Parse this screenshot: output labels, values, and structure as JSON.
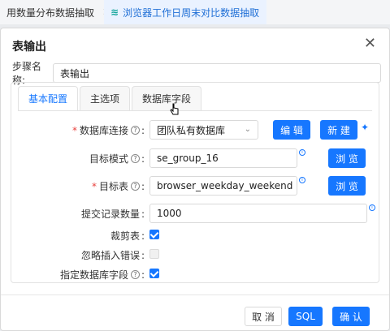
{
  "bg_tabs": [
    {
      "label": "用数量分布数据抽取"
    },
    {
      "label": "浏览器工作日周末对比数据抽取"
    }
  ],
  "dialog": {
    "title": "表输出",
    "step_label": "步骤名称:",
    "step_value": "表输出",
    "tabs": [
      {
        "label": "基本配置",
        "active": true
      },
      {
        "label": "主选项",
        "active": false
      },
      {
        "label": "数据库字段",
        "active": false
      }
    ],
    "form": {
      "db_conn_label": "数据库连接",
      "db_conn_value": "团队私有数据库",
      "edit_btn": "编 辑",
      "new_btn": "新 建",
      "schema_label": "目标模式",
      "schema_value": "se_group_16",
      "browse_btn": "浏 览",
      "table_label": "目标表",
      "table_value": "browser_weekday_weekend",
      "commit_label": "提交记录数量",
      "commit_value": "1000",
      "truncate_label": "裁剪表",
      "truncate_checked": true,
      "ignore_label": "忽略插入错误",
      "ignore_checked": false,
      "specify_label": "指定数据库字段",
      "specify_checked": true
    },
    "footer": {
      "cancel": "取 消",
      "sql": "SQL",
      "confirm": "确 认"
    }
  },
  "colors": {
    "primary": "#1677ff",
    "required": "#e8413d",
    "tab_accent": "#13a59a"
  }
}
